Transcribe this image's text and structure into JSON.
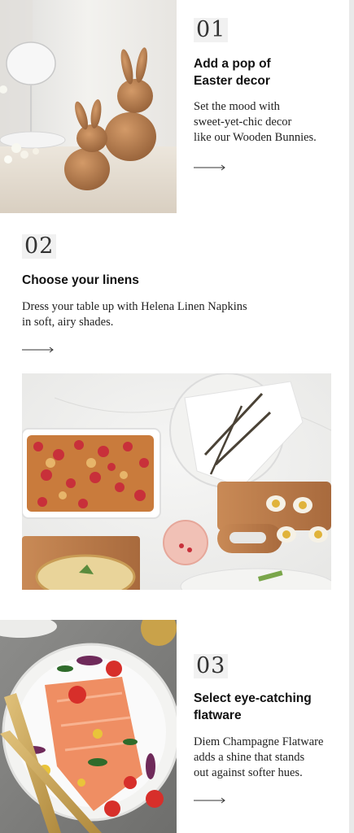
{
  "sections": [
    {
      "number": "01",
      "title_line1": "Add a pop of",
      "title_line2": "Easter decor",
      "body_line1": "Set the mood with",
      "body_line2": "sweet-yet-chic decor",
      "body_line3": "like our Wooden Bunnies.",
      "image_icon": "wooden-bunnies-image"
    },
    {
      "number": "02",
      "title": "Choose your linens",
      "body_line1": "Dress your table up with Helena Linen Napkins",
      "body_line2": "in soft, airy shades.",
      "image_icon": "table-setting-image"
    },
    {
      "number": "03",
      "title_line1": "Select eye-catching",
      "title_line2": "flatware",
      "body_line1": "Diem Champagne Flatware",
      "body_line2": "adds a shine that stands",
      "body_line3": "out against softer hues.",
      "image_icon": "salmon-plate-image"
    }
  ],
  "colors": {
    "accent_wood": "#b5784a",
    "background": "#ffffff",
    "number_bg": "#f1f1f1"
  }
}
